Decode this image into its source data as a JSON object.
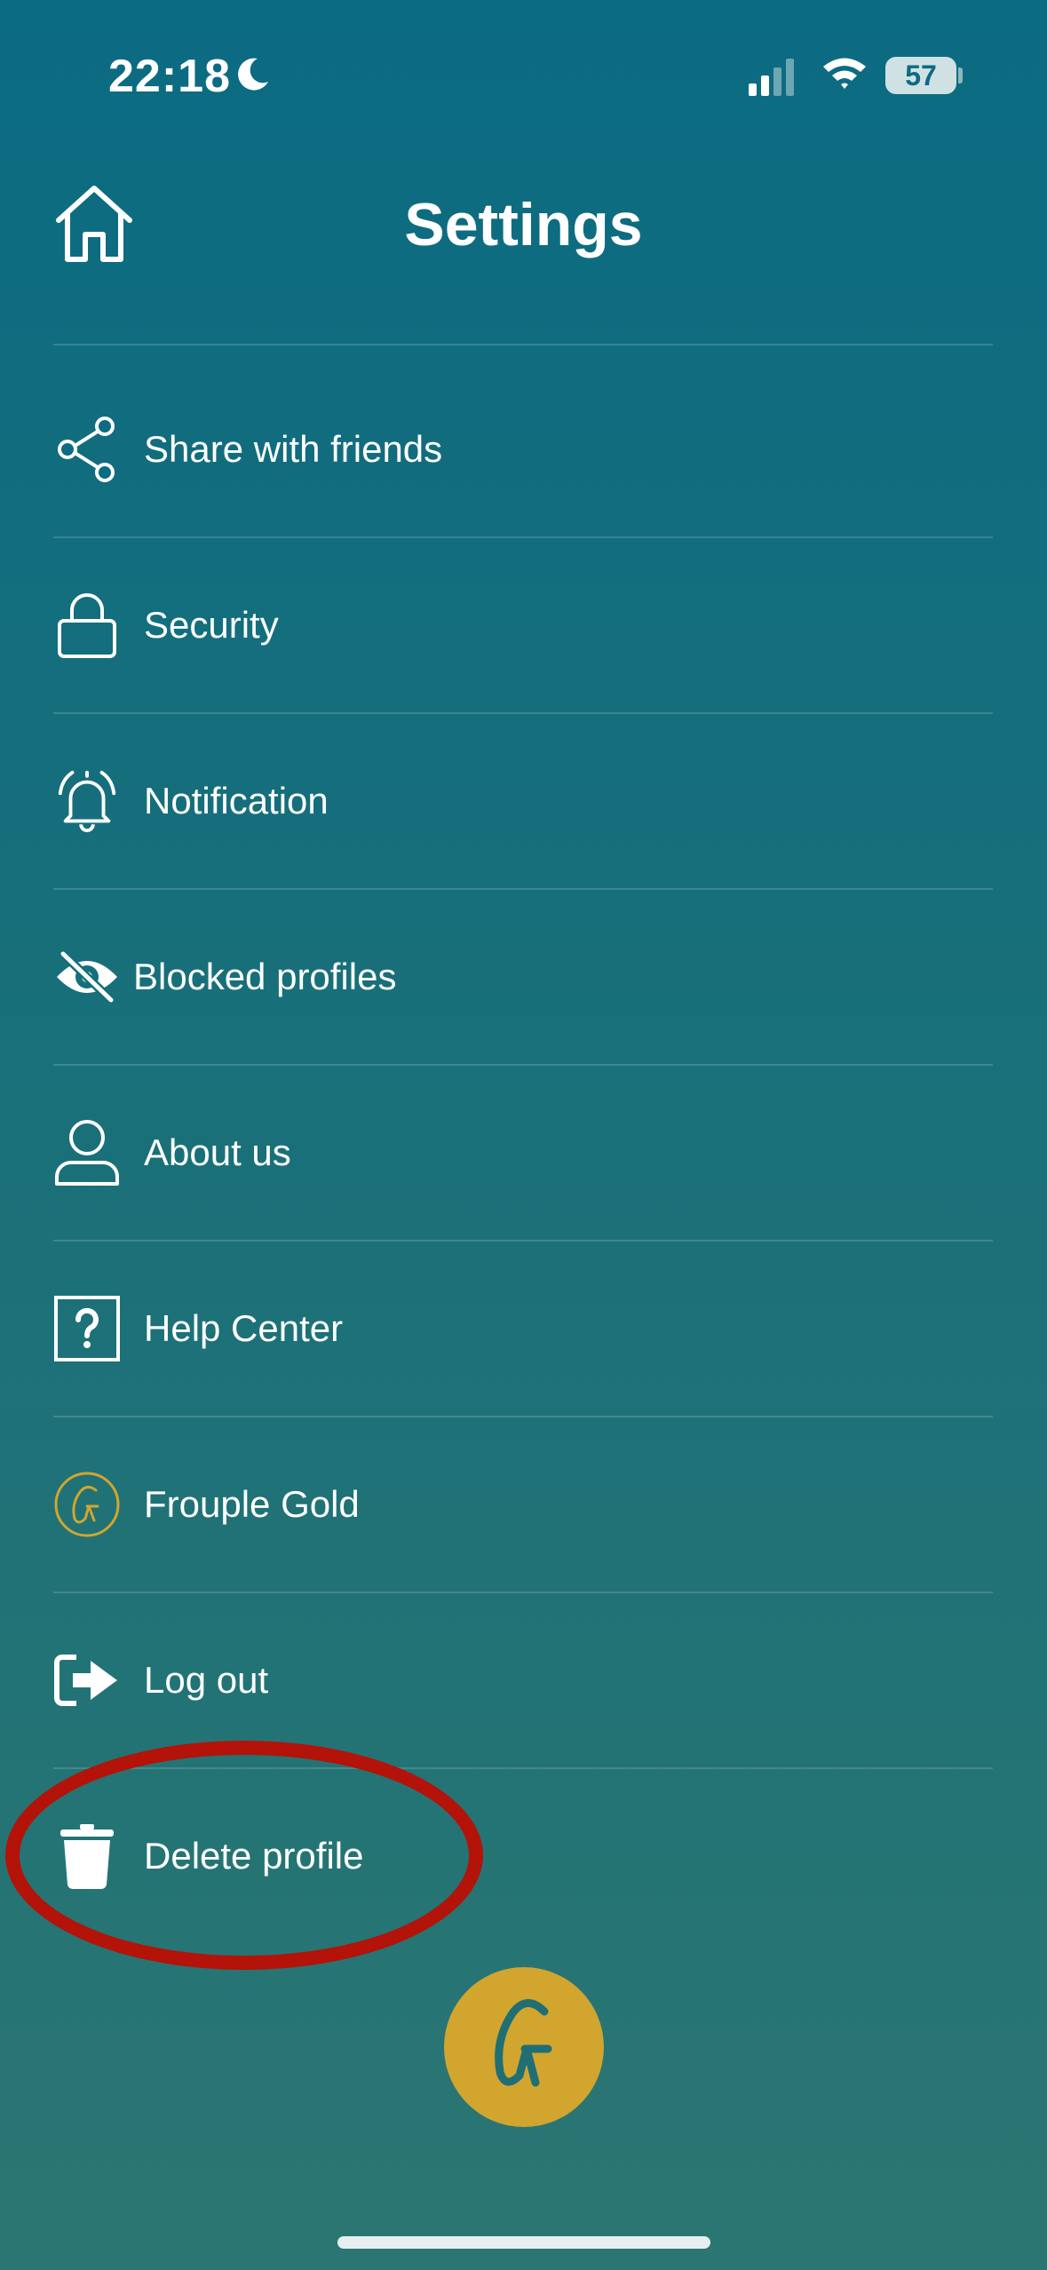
{
  "status_bar": {
    "time": "22:18",
    "battery": "57"
  },
  "header": {
    "title": "Settings"
  },
  "menu": [
    {
      "id": "share",
      "label": "Share with friends",
      "icon": "share-icon"
    },
    {
      "id": "security",
      "label": "Security",
      "icon": "lock-icon"
    },
    {
      "id": "notification",
      "label": "Notification",
      "icon": "bell-icon"
    },
    {
      "id": "blocked",
      "label": "Blocked profiles",
      "icon": "eye-slash-icon"
    },
    {
      "id": "about",
      "label": "About us",
      "icon": "user-icon"
    },
    {
      "id": "help",
      "label": "Help Center",
      "icon": "question-icon"
    },
    {
      "id": "gold",
      "label": "Frouple Gold",
      "icon": "gold-logo-icon"
    },
    {
      "id": "logout",
      "label": "Log out",
      "icon": "logout-icon"
    },
    {
      "id": "delete",
      "label": "Delete profile",
      "icon": "trash-icon"
    }
  ],
  "colors": {
    "gold": "#d2a52f",
    "highlight_circle": "#b31308",
    "bg_top": "#0b6b82",
    "bg_bottom": "#2b7672"
  }
}
